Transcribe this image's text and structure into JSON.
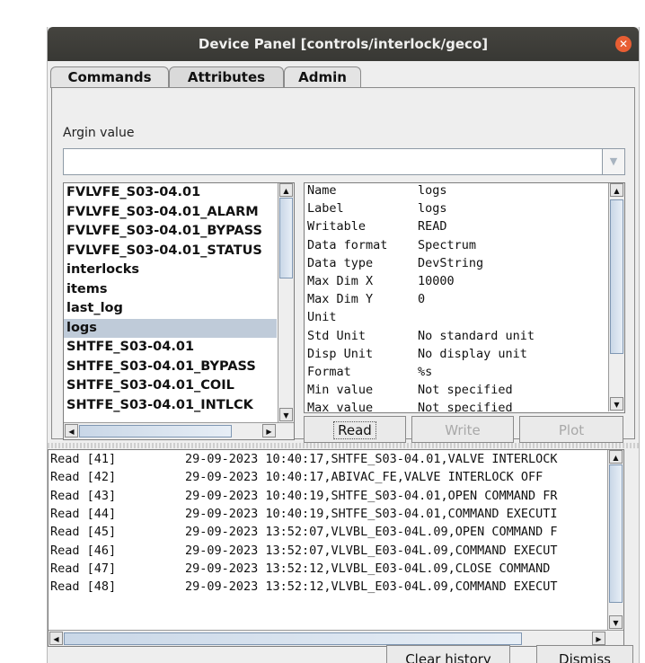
{
  "window": {
    "title": "Device Panel [controls/interlock/geco]"
  },
  "tabs": [
    {
      "label": "Commands"
    },
    {
      "label": "Attributes"
    },
    {
      "label": "Admin"
    }
  ],
  "argin": {
    "label": "Argin value",
    "value": ""
  },
  "attributes": [
    "FVLVFE_S03-04.01",
    "FVLVFE_S03-04.01_ALARM",
    "FVLVFE_S03-04.01_BYPASS",
    "FVLVFE_S03-04.01_STATUS",
    "interlocks",
    "items",
    "last_log",
    "logs",
    "SHTFE_S03-04.01",
    "SHTFE_S03-04.01_BYPASS",
    "SHTFE_S03-04.01_COIL",
    "SHTFE_S03-04.01_INTLCK"
  ],
  "selected_attribute": "logs",
  "properties": [
    {
      "name": "Name",
      "value": "logs"
    },
    {
      "name": "Label",
      "value": "logs"
    },
    {
      "name": "Writable",
      "value": "READ"
    },
    {
      "name": "Data format",
      "value": "Spectrum"
    },
    {
      "name": "Data type",
      "value": "DevString"
    },
    {
      "name": "Max Dim X",
      "value": "10000"
    },
    {
      "name": "Max Dim Y",
      "value": "0"
    },
    {
      "name": "Unit",
      "value": ""
    },
    {
      "name": "Std Unit",
      "value": "No standard unit"
    },
    {
      "name": "Disp Unit",
      "value": "No display unit"
    },
    {
      "name": "Format",
      "value": "%s"
    },
    {
      "name": "Min value",
      "value": "Not specified"
    },
    {
      "name": "Max value",
      "value": "Not specified"
    }
  ],
  "buttons": {
    "read": "Read",
    "write": "Write",
    "plot": "Plot"
  },
  "log": [
    {
      "id": "Read [41]",
      "text": "29-09-2023 10:40:17,SHTFE_S03-04.01,VALVE INTERLOCK"
    },
    {
      "id": "Read [42]",
      "text": "29-09-2023 10:40:17,ABIVAC_FE,VALVE INTERLOCK OFF"
    },
    {
      "id": "Read [43]",
      "text": "29-09-2023 10:40:19,SHTFE_S03-04.01,OPEN COMMAND FR"
    },
    {
      "id": "Read [44]",
      "text": "29-09-2023 10:40:19,SHTFE_S03-04.01,COMMAND EXECUTI"
    },
    {
      "id": "Read [45]",
      "text": "29-09-2023 13:52:07,VLVBL_E03-04L.09,OPEN COMMAND F"
    },
    {
      "id": "Read [46]",
      "text": "29-09-2023 13:52:07,VLVBL_E03-04L.09,COMMAND EXECUT"
    },
    {
      "id": "Read [47]",
      "text": "29-09-2023 13:52:12,VLVBL_E03-04L.09,CLOSE COMMAND "
    },
    {
      "id": "Read [48]",
      "text": "29-09-2023 13:52:12,VLVBL_E03-04L.09,COMMAND EXECUT"
    }
  ],
  "bottom": {
    "clear": "Clear history",
    "dismiss": "Dismiss"
  }
}
